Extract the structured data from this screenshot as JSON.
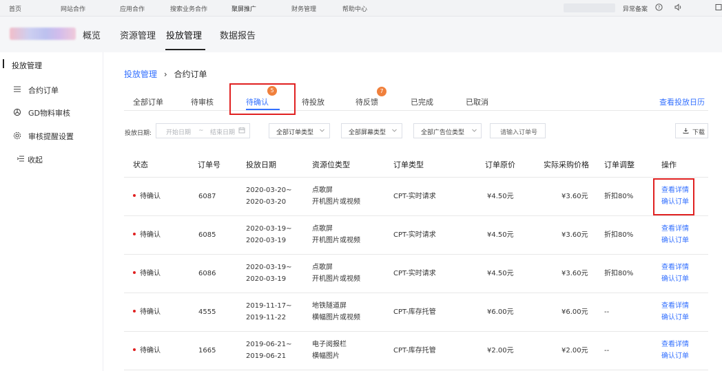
{
  "topbar": {
    "items": [
      "首页",
      "网站合作",
      "应用合作",
      "搜索业务合作",
      "聚屏推广",
      "财务管理",
      "帮助中心"
    ],
    "record_link": "异常备案",
    "help_icon": "help-icon",
    "sound_icon": "sound-icon"
  },
  "mainnav": {
    "items": [
      "概览",
      "资源管理",
      "投放管理",
      "数据报告"
    ],
    "active": "投放管理"
  },
  "sidebar": {
    "title": "投放管理",
    "items": [
      {
        "label": "合约订单",
        "icon": "list-icon"
      },
      {
        "label": "GD物料审核",
        "icon": "target-icon"
      },
      {
        "label": "审核提醒设置",
        "icon": "gear-icon"
      },
      {
        "label": "收起",
        "icon": "collapse-icon"
      }
    ]
  },
  "breadcrumb": {
    "parent": "投放管理",
    "sep": "›",
    "current": "合约订单"
  },
  "tabs": [
    {
      "label": "全部订单"
    },
    {
      "label": "待审核"
    },
    {
      "label": "待确认",
      "badge": "5"
    },
    {
      "label": "待投放"
    },
    {
      "label": "待反馈",
      "badge": "7"
    },
    {
      "label": "已完成"
    },
    {
      "label": "已取消"
    }
  ],
  "calendar_link": "查看投放日历",
  "filters": {
    "date_label": "投放日期:",
    "start_placeholder": "开始日期",
    "range_sep": "~",
    "end_placeholder": "结束日期",
    "order_type": "全部订单类型",
    "screen_type": "全部屏幕类型",
    "ad_type": "全部广告位类型",
    "search_placeholder": "请输入订单号",
    "download": "下载"
  },
  "table": {
    "headers": [
      "状态",
      "订单号",
      "投放日期",
      "资源位类型",
      "订单类型",
      "订单原价",
      "实际采购价格",
      "订单调整",
      "操作"
    ],
    "rows": [
      {
        "status": "待确认",
        "id": "6087",
        "date1": "2020-03-20~",
        "date2": "2020-03-20",
        "res1": "点歌屏",
        "res2": "开机图片或视频",
        "type": "CPT-实时请求",
        "price": "¥4.50元",
        "actual": "¥3.60元",
        "adjust": "折扣80%",
        "op1": "查看详情",
        "op2": "确认订单"
      },
      {
        "status": "待确认",
        "id": "6085",
        "date1": "2020-03-19~",
        "date2": "2020-03-19",
        "res1": "点歌屏",
        "res2": "开机图片或视频",
        "type": "CPT-实时请求",
        "price": "¥4.50元",
        "actual": "¥3.60元",
        "adjust": "折扣80%",
        "op1": "查看详情",
        "op2": "确认订单"
      },
      {
        "status": "待确认",
        "id": "6086",
        "date1": "2020-03-19~",
        "date2": "2020-03-19",
        "res1": "点歌屏",
        "res2": "开机图片或视频",
        "type": "CPT-实时请求",
        "price": "¥4.50元",
        "actual": "¥3.60元",
        "adjust": "折扣80%",
        "op1": "查看详情",
        "op2": "确认订单"
      },
      {
        "status": "待确认",
        "id": "4555",
        "date1": "2019-11-17~",
        "date2": "2019-11-22",
        "res1": "地铁隧道屏",
        "res2": "横幅图片或视频",
        "type": "CPT-库存托管",
        "price": "¥6.00元",
        "actual": "¥6.00元",
        "adjust": "--",
        "op1": "查看详情",
        "op2": "确认订单"
      },
      {
        "status": "待确认",
        "id": "1665",
        "date1": "2019-06-21~",
        "date2": "2019-06-21",
        "res1": "电子阅报栏",
        "res2": "横幅图片",
        "type": "CPT-库存托管",
        "price": "¥2.00元",
        "actual": "¥2.00元",
        "adjust": "--",
        "op1": "查看详情",
        "op2": "确认订单"
      }
    ]
  },
  "colors": {
    "accent": "#3370ff",
    "badge": "#f0803c",
    "highlight": "#e02020"
  }
}
